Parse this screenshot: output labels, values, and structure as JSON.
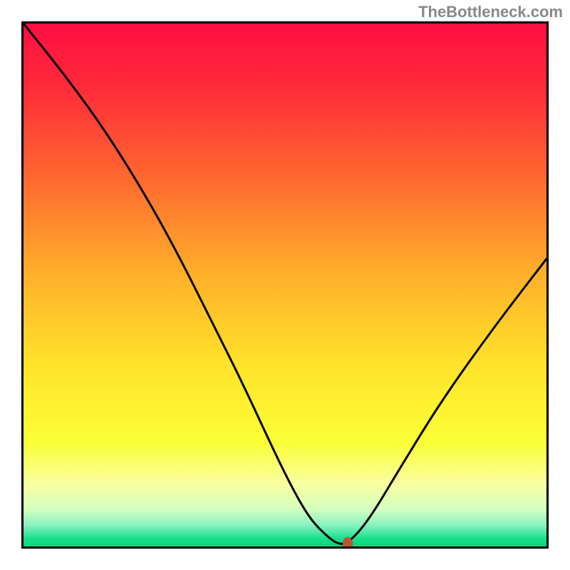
{
  "watermark": "TheBottleneck.com",
  "chart_data": {
    "type": "line",
    "title": "",
    "xlabel": "",
    "ylabel": "",
    "xlim": [
      0,
      100
    ],
    "ylim": [
      0,
      100
    ],
    "grid": false,
    "legend": false,
    "background_gradient_stops": [
      {
        "offset": 0.0,
        "color": "#ff0e42"
      },
      {
        "offset": 0.12,
        "color": "#ff2a3a"
      },
      {
        "offset": 0.3,
        "color": "#ff6a2f"
      },
      {
        "offset": 0.48,
        "color": "#ffb02a"
      },
      {
        "offset": 0.65,
        "color": "#ffe22a"
      },
      {
        "offset": 0.8,
        "color": "#fbff35"
      },
      {
        "offset": 0.88,
        "color": "#f9ffa0"
      },
      {
        "offset": 0.93,
        "color": "#d2ffc0"
      },
      {
        "offset": 0.96,
        "color": "#86f1c0"
      },
      {
        "offset": 0.985,
        "color": "#17e08a"
      },
      {
        "offset": 1.0,
        "color": "#07d67e"
      }
    ],
    "series": [
      {
        "name": "bottleneck-curve",
        "color": "#000000",
        "x": [
          0,
          8,
          16,
          24,
          30,
          36,
          42,
          48,
          52,
          55,
          58,
          60,
          62,
          66,
          72,
          80,
          90,
          100
        ],
        "values": [
          100,
          90,
          79,
          66,
          55,
          43,
          31,
          18,
          10,
          5,
          2,
          0.5,
          0.5,
          5,
          15,
          28,
          42,
          55
        ]
      }
    ],
    "marker": {
      "x": 62,
      "y": 0.5,
      "color": "#c1523a"
    }
  }
}
